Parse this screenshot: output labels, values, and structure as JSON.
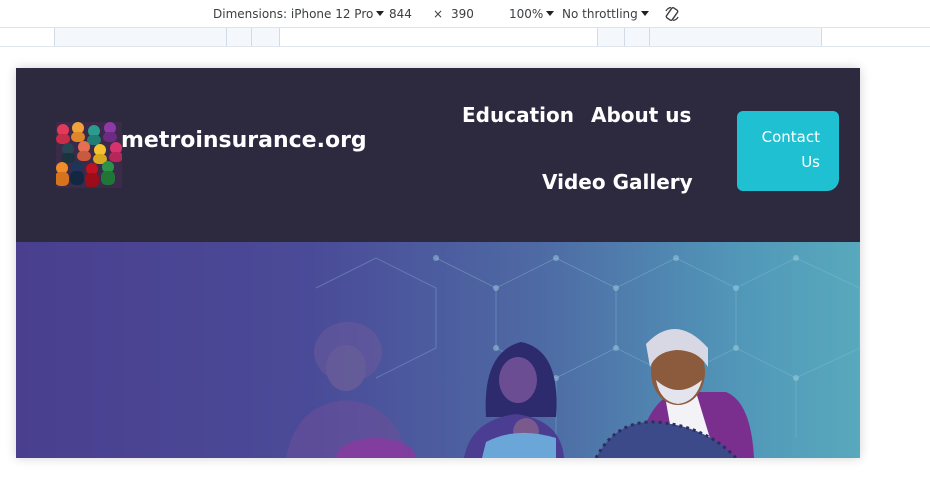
{
  "devtools": {
    "device_label": "Dimensions: iPhone 12 Pro",
    "width": "844",
    "times": "×",
    "height": "390",
    "zoom": "100%",
    "throttling": "No throttling",
    "icons": [
      "caret-down-icon",
      "rotate-icon"
    ]
  },
  "site": {
    "logo_icon": "people-silhouettes-logo",
    "name": "metroinsurance.org",
    "nav": {
      "education": "Education",
      "about": "About us",
      "video": "Video Gallery"
    },
    "contact": "Contact Us",
    "colors": {
      "header_bg": "#2d2a40",
      "accent": "#1ec0d2"
    }
  },
  "hero": {
    "image": "family-with-elderly-man-illustration"
  }
}
